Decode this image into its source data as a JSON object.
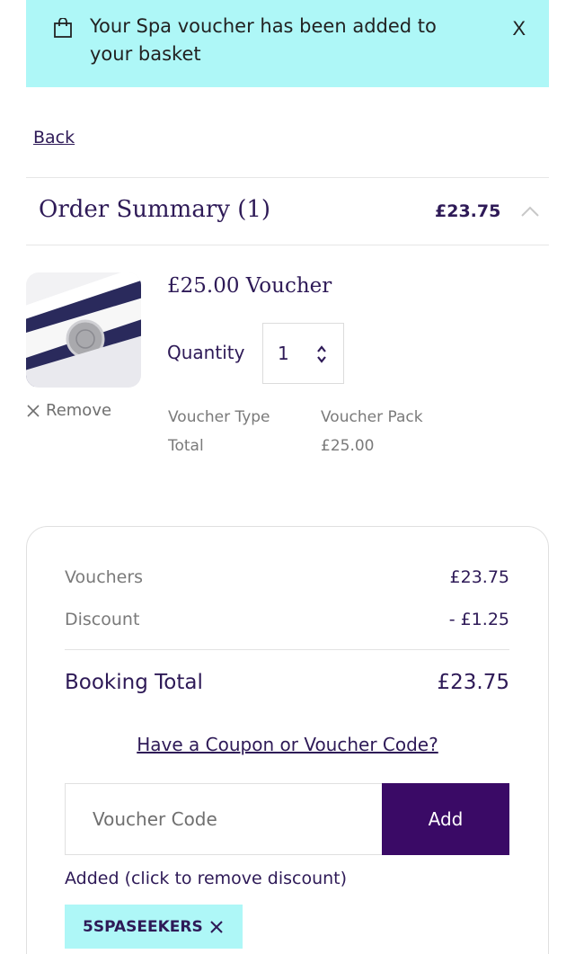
{
  "banner": {
    "message": "Your Spa voucher has been added to your basket",
    "close_label": "X"
  },
  "nav": {
    "back_label": "Back"
  },
  "order_summary": {
    "title": "Order Summary (1)",
    "price": "£23.75"
  },
  "item": {
    "title": "£25.00 Voucher",
    "quantity_label": "Quantity",
    "quantity_value": "1",
    "remove_label": "Remove",
    "voucher_type_label": "Voucher Type",
    "voucher_type_value": "Voucher Pack",
    "total_label": "Total",
    "total_value": "£25.00"
  },
  "totals": {
    "vouchers_label": "Vouchers",
    "vouchers_value": "£23.75",
    "discount_label": "Discount",
    "discount_value": "- £1.25",
    "booking_total_label": "Booking Total",
    "booking_total_value": "£23.75"
  },
  "coupon": {
    "link_label": "Have a Coupon or Voucher Code?",
    "input_placeholder": "Voucher Code",
    "add_label": "Add",
    "added_note": "Added (click to remove discount)",
    "applied_code": "5SPASEEKERS"
  },
  "colors": {
    "accent_cyan": "#aef7f7",
    "brand_purple": "#3a0a66",
    "text_purple": "#2e1a57"
  }
}
